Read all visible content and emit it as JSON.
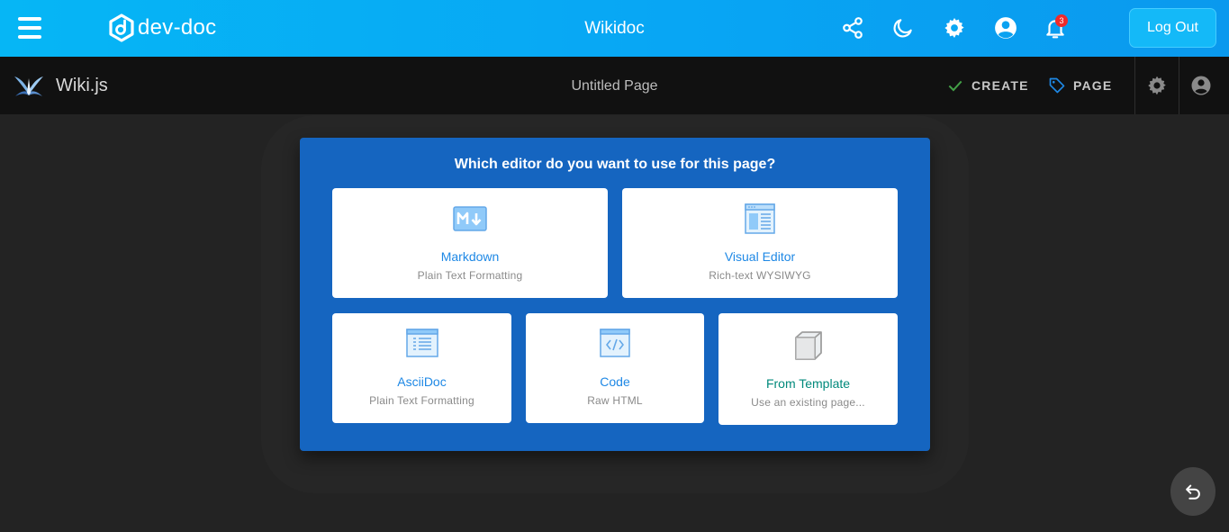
{
  "topbar": {
    "logo_text": "dev-doc",
    "title": "Wikidoc",
    "notification_count": "3",
    "logout_label": "Log Out",
    "icons": [
      "menu-icon",
      "share-icon",
      "moon-icon",
      "gear-icon",
      "account-icon",
      "bell-icon"
    ]
  },
  "wiki": {
    "name": "Wiki.js",
    "page_title": "Untitled Page",
    "create_label": "CREATE",
    "page_label": "PAGE",
    "colors": {
      "create_check": "#43a047",
      "page_tag": "#1e88e5"
    }
  },
  "dialog": {
    "question": "Which editor do you want to use for this page?",
    "editors": [
      {
        "title": "Markdown",
        "subtitle": "Plain Text Formatting",
        "icon": "markdown-icon"
      },
      {
        "title": "Visual Editor",
        "subtitle": "Rich-text WYSIWYG",
        "icon": "visual-editor-icon"
      },
      {
        "title": "AsciiDoc",
        "subtitle": "Plain Text Formatting",
        "icon": "asciidoc-icon"
      },
      {
        "title": "Code",
        "subtitle": "Raw HTML",
        "icon": "code-icon"
      },
      {
        "title": "From Template",
        "subtitle": "Use an existing page...",
        "icon": "cube-icon"
      }
    ],
    "colors": {
      "background": "#1565c0",
      "title": "#1e88e5",
      "template_title": "#00897b"
    }
  }
}
